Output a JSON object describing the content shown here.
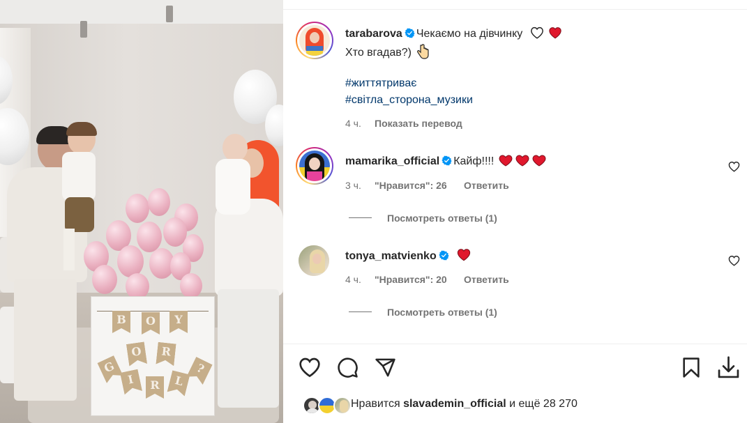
{
  "post": {
    "author": {
      "username": "tarabarova",
      "verified": true,
      "avatar": "avatar-tarabarova"
    },
    "caption_line1": "Чекаємо на дівчинку",
    "caption_line2": "Хто вгадав?)",
    "hashtags": [
      "#життятриває",
      "#світла_сторона_музики"
    ],
    "time": "4 ч.",
    "translate_label": "Показать перевод",
    "media": {
      "box_flags_row1": [
        "B",
        "O",
        "Y"
      ],
      "box_flags_row2": [
        "O",
        "R"
      ],
      "box_flags_row3": [
        "G",
        "I",
        "R",
        "L",
        "?"
      ]
    }
  },
  "comments": [
    {
      "username": "mamarika_official",
      "verified": true,
      "text": "Кайф!!!!",
      "time": "3 ч.",
      "likes_label": "\"Нравится\": 26",
      "reply_label": "Ответить",
      "view_replies_label": "Посмотреть ответы (1)",
      "avatar": "avatar-mamarika"
    },
    {
      "username": "tonya_matvienko",
      "verified": true,
      "text": "",
      "time": "4 ч.",
      "likes_label": "\"Нравится\": 20",
      "reply_label": "Ответить",
      "view_replies_label": "Посмотреть ответы (1)",
      "avatar": "avatar-tonya"
    }
  ],
  "actions": {
    "like_icon": "heart-outline-icon",
    "comment_icon": "comment-icon",
    "share_icon": "paper-plane-icon",
    "save_icon": "bookmark-icon",
    "download_icon": "download-icon"
  },
  "likes": {
    "prefix": "Нравится",
    "user": "slavademin_official",
    "suffix": "и ещё 28 270"
  },
  "colors": {
    "text": "#262626",
    "muted": "#737373",
    "hashtag": "#00376b",
    "verified": "#0095f6",
    "heart_red": "#ed4956",
    "divider": "#efefef"
  }
}
